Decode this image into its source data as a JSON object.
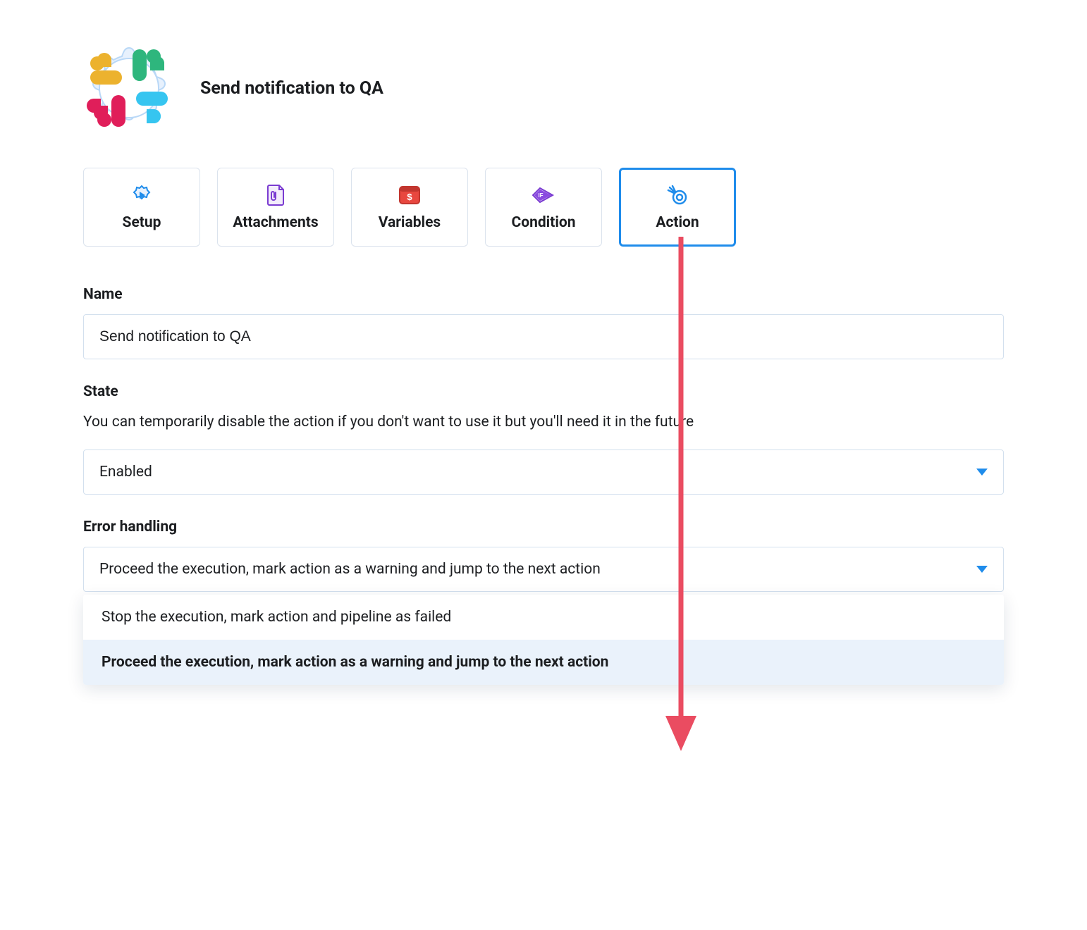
{
  "header": {
    "title": "Send notification to QA"
  },
  "tabs": [
    {
      "id": "setup",
      "label": "Setup",
      "active": false
    },
    {
      "id": "attachments",
      "label": "Attachments",
      "active": false
    },
    {
      "id": "variables",
      "label": "Variables",
      "active": false
    },
    {
      "id": "condition",
      "label": "Condition",
      "active": false
    },
    {
      "id": "action",
      "label": "Action",
      "active": true
    }
  ],
  "form": {
    "name": {
      "label": "Name",
      "value": "Send notification to QA"
    },
    "state": {
      "label": "State",
      "helper": "You can temporarily disable the action if you don't want to use it but you'll need it in the future",
      "selected": "Enabled"
    },
    "errorHandling": {
      "label": "Error handling",
      "selected": "Proceed the execution, mark action as a warning and jump to the next action",
      "options": [
        {
          "label": "Stop the execution, mark action and pipeline as failed",
          "selected": false
        },
        {
          "label": "Proceed the execution, mark action as a warning and jump to the next action",
          "selected": true
        }
      ]
    }
  },
  "colors": {
    "accent": "#1f8ceb",
    "border": "#d3e0ee",
    "arrow": "#ea4c61"
  }
}
